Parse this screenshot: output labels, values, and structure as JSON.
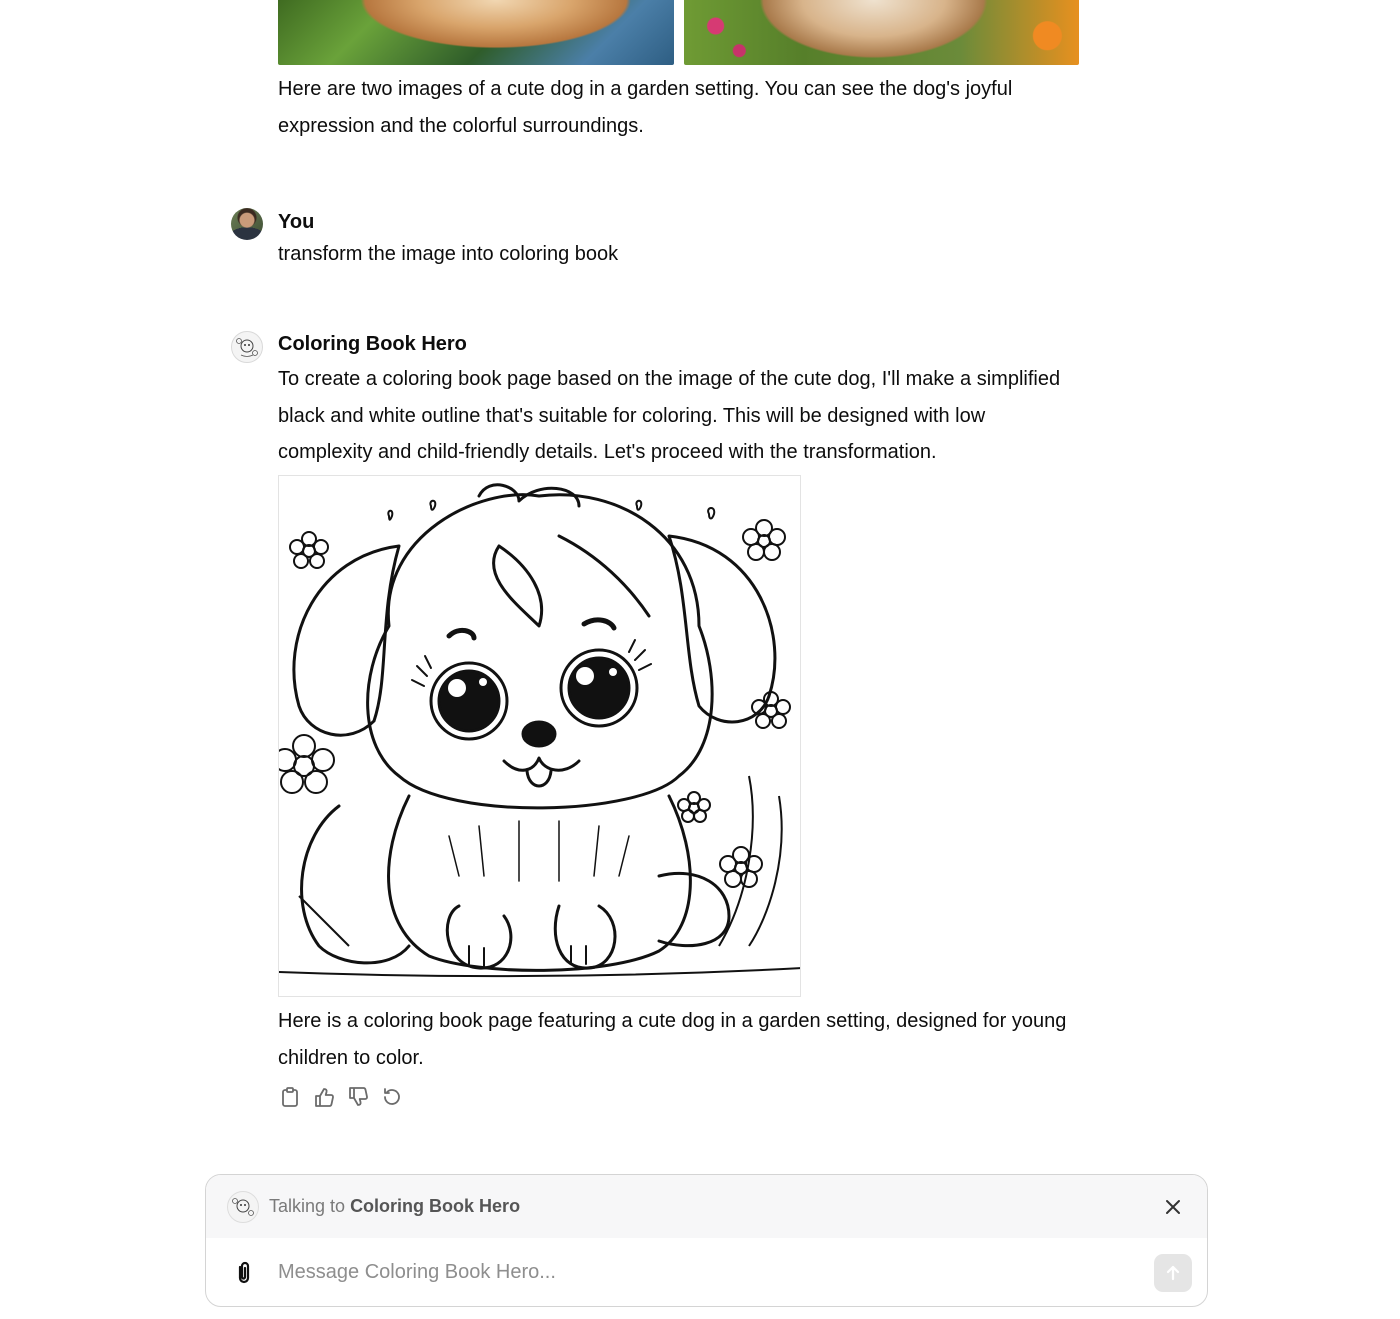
{
  "prior_message": {
    "text": "Here are two images of a cute dog in a garden setting. You can see the dog's joyful expression and the colorful surroundings."
  },
  "user_message": {
    "author": "You",
    "text": "transform the image into coloring book"
  },
  "bot_message": {
    "author": "Coloring Book Hero",
    "intro": "To create a coloring book page based on the image of the cute dog, I'll make a simplified black and white outline that's suitable for coloring. This will be designed with low complexity and child-friendly details. Let's proceed with the transformation.",
    "outro": "Here is a coloring book page featuring a cute dog in a garden setting, designed for young children to color."
  },
  "actions": {
    "icons": [
      "clipboard-icon",
      "thumbs-up-icon",
      "thumbs-down-icon",
      "regenerate-icon"
    ]
  },
  "composer": {
    "talking_prefix": "Talking to",
    "talking_name": "Coloring Book Hero",
    "placeholder": "Message Coloring Book Hero..."
  }
}
